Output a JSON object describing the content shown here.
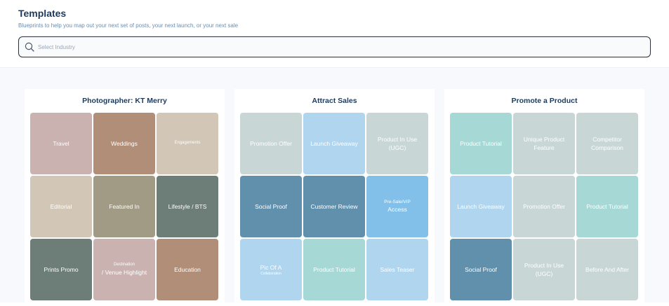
{
  "header": {
    "title": "Templates",
    "subtitle": "Blueprints to help you map out your next set of posts, your next launch, or your next sale",
    "search_placeholder": "Select Industry",
    "search_value": ""
  },
  "cards": [
    {
      "title": "Photographer: KT Merry",
      "tiles": [
        {
          "label": "Travel",
          "color": "#c9b2b0"
        },
        {
          "label": "Weddings",
          "color": "#b08e78"
        },
        {
          "label": "Engagements",
          "color": "#d2c6b6",
          "size": "tiny"
        },
        {
          "label": "Editorial",
          "color": "#d2c6b6"
        },
        {
          "label": "Featured In",
          "color": "#a19a85"
        },
        {
          "label": "Lifestyle / BTS",
          "color": "#6d7d78"
        },
        {
          "label": "Prints Promo",
          "color": "#6d7d78"
        },
        {
          "small": "Destination",
          "label": "/ Venue Highlight",
          "color": "#c9b2b0"
        },
        {
          "label": "Education",
          "color": "#b08e78"
        }
      ]
    },
    {
      "title": "Attract Sales",
      "tiles": [
        {
          "label": "Promotion Offer",
          "color": "#c8d6d6"
        },
        {
          "label": "Launch Giveaway",
          "color": "#b0d5ef"
        },
        {
          "label": "Product In Use",
          "label2": "(UGC)",
          "color": "#c8d6d6"
        },
        {
          "label": "Social Proof",
          "color": "#6190ad"
        },
        {
          "label": "Customer Review",
          "color": "#6190ad"
        },
        {
          "small": "Pre-Sale/VIP",
          "label": "Access",
          "color": "#82c0ea"
        },
        {
          "label": "Pic Of A",
          "tiny": "Collaboration",
          "color": "#b0d5ef"
        },
        {
          "label": "Product Tutorial",
          "color": "#a6d9d6"
        },
        {
          "label": "Sales Teaser",
          "color": "#b0d5ef"
        }
      ]
    },
    {
      "title": "Promote a Product",
      "tiles": [
        {
          "label": "Product Tutorial",
          "color": "#a6d9d6"
        },
        {
          "label": "Unique Product",
          "label2": "Feature",
          "color": "#c8d6d6"
        },
        {
          "label": "Competitor",
          "label2": "Comparison",
          "color": "#c8d6d6"
        },
        {
          "label": "Launch Giveaway",
          "color": "#b0d5ef"
        },
        {
          "label": "Promotion Offer",
          "color": "#c8d6d6"
        },
        {
          "label": "Product Tutorial",
          "color": "#a6d9d6"
        },
        {
          "label": "Social Proof",
          "color": "#6190ad"
        },
        {
          "label": "Product In Use",
          "label2": "(UGC)",
          "color": "#c8d6d6"
        },
        {
          "label": "Before And After",
          "color": "#c8d6d6"
        }
      ]
    }
  ]
}
